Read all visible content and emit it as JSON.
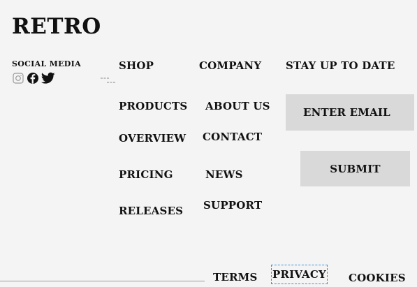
{
  "brand": {
    "logo": "RETRO"
  },
  "social": {
    "label": "SOCIAL MEDIA",
    "icons": [
      "instagram-icon",
      "facebook-icon",
      "twitter-icon"
    ]
  },
  "nav": {
    "shop": {
      "heading": "SHOP",
      "items": [
        "PRODUCTS",
        "OVERVIEW",
        "PRICING",
        "RELEASES"
      ]
    },
    "company": {
      "heading": "COMPANY",
      "items": [
        "ABOUT US",
        "CONTACT",
        "NEWS",
        "SUPPORT"
      ]
    }
  },
  "newsletter": {
    "heading": "STAY UP TO DATE",
    "email_placeholder": "ENTER EMAIL",
    "submit_label": "SUBMIT"
  },
  "legal": {
    "terms": "TERMS",
    "privacy": "PRIVACY",
    "cookies": "COOKIES"
  },
  "colors": {
    "background": "#f4f4f4",
    "text": "#111111",
    "form_fill": "#d9d9d9",
    "focus_outline": "#3a8fd8"
  }
}
